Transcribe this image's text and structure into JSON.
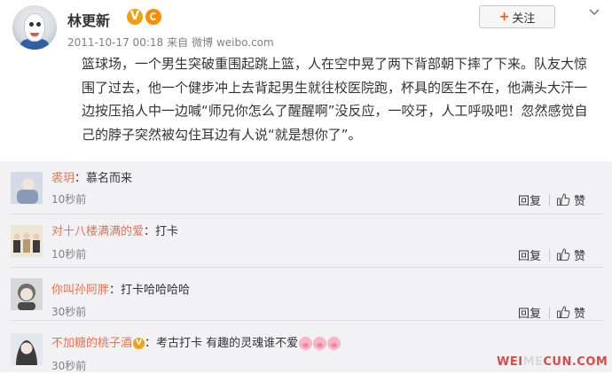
{
  "post": {
    "username": "林更新",
    "verified_badge": "V",
    "meta": {
      "date": "2011-10-17 00:18",
      "source_prefix": "来自",
      "source": "微博 weibo.com"
    },
    "follow_label": "关注",
    "follow_plus": "+",
    "content": "篮球场，一个男生突破重围起跳上篮，人在空中晃了两下背部朝下摔了下来。队友大惊围了过去，他一个健步冲上去背起男生就往校医院跑，杯具的医生不在，他满头大汗一边按压掐人中一边喊“师兄你怎么了醒醒啊”没反应，一咬牙，人工呼吸吧！忽然感觉自己的脖子突然被勾住耳边有人说“就是想你了”。"
  },
  "comments": [
    {
      "name": "裘玥",
      "text": "：慕名而来",
      "time": "10秒前",
      "reply": "回复",
      "like": "赞"
    },
    {
      "name": "对十八楼满满的爱",
      "text": "：打卡",
      "time": "10秒前",
      "reply": "回复",
      "like": "赞"
    },
    {
      "name": "你叫孙阿胖",
      "text": "：打卡哈哈哈哈",
      "time": "30秒前",
      "reply": "回复",
      "like": "赞"
    },
    {
      "name": "不加糖的桃子酒",
      "text": "：考古打卡 有趣的灵魂谁不爱",
      "time": "30秒前",
      "reply": "回复",
      "like": "赞"
    }
  ],
  "watermark": {
    "part1": "WEI",
    "part2": "ME",
    "part3": "CUN.COM"
  },
  "colors": {
    "username": "#eb7350",
    "accent": "#e8581a",
    "badge": "#f0a010",
    "comment_bg": "#f2f2f5"
  }
}
